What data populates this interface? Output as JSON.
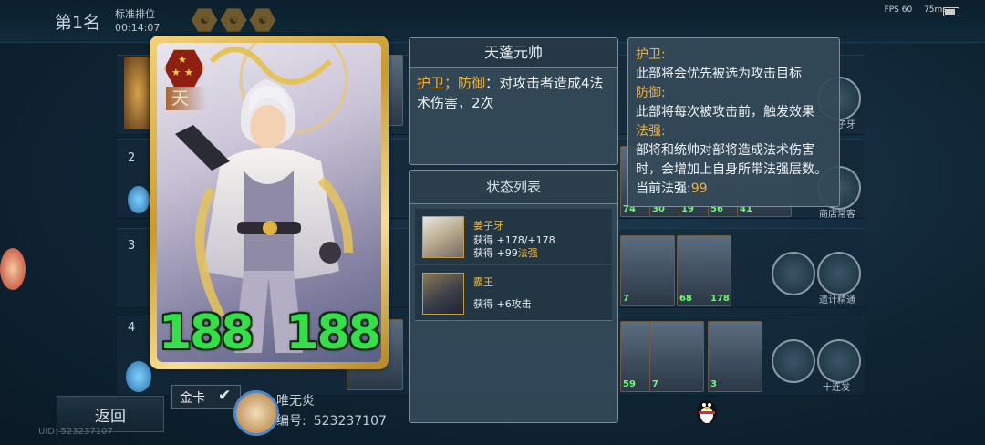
{
  "header": {
    "rank_title": "第1名",
    "mode": "标准排位",
    "time": "00:14:07",
    "fps": "FPS 60",
    "ping": "75ms"
  },
  "card": {
    "corner_char": "天",
    "stars": 3,
    "attack": "188",
    "health": "188",
    "type_label": "金卡"
  },
  "skill": {
    "name": "天蓬元帅",
    "keywords": "护卫；防御",
    "text": "：对攻击者造成4法术伤害，2次"
  },
  "status": {
    "title": "状态列表",
    "items": [
      {
        "name": "姜子牙",
        "line1": "获得 +178/+178",
        "line2_prefix": "获得 +99",
        "line2_kw": "法强"
      },
      {
        "name": "霸王",
        "line1": "获得 +6攻击"
      }
    ]
  },
  "tooltip": {
    "h1": "护卫:",
    "p1": "此部将会优先被选为攻击目标",
    "h2": "防御:",
    "p2": "此部将每次被攻击前，触发效果",
    "h3": "法强:",
    "p3": "部将和统帅对部将造成法术伤害时，会增加上自身所带法强层数。当前法强:",
    "p3_value": "99"
  },
  "player": {
    "name": "唯无炎",
    "id_label": "编号:",
    "id": "523237107"
  },
  "bottom": {
    "back": "返回",
    "uid": "UID: 523237107"
  },
  "board": {
    "levels": [
      "2",
      "3",
      "4"
    ],
    "side_labels": [
      "子牙",
      "商店常客",
      "遗计精通",
      "十连发"
    ],
    "minicard_nums": [
      "74",
      "30",
      "19",
      "56",
      "41",
      "7",
      "68",
      "178",
      "59",
      "7",
      "3"
    ]
  },
  "colors": {
    "stat_green": "#33e04a",
    "keyword_orange": "#f2b13c",
    "card_gold": "#e4b453"
  }
}
